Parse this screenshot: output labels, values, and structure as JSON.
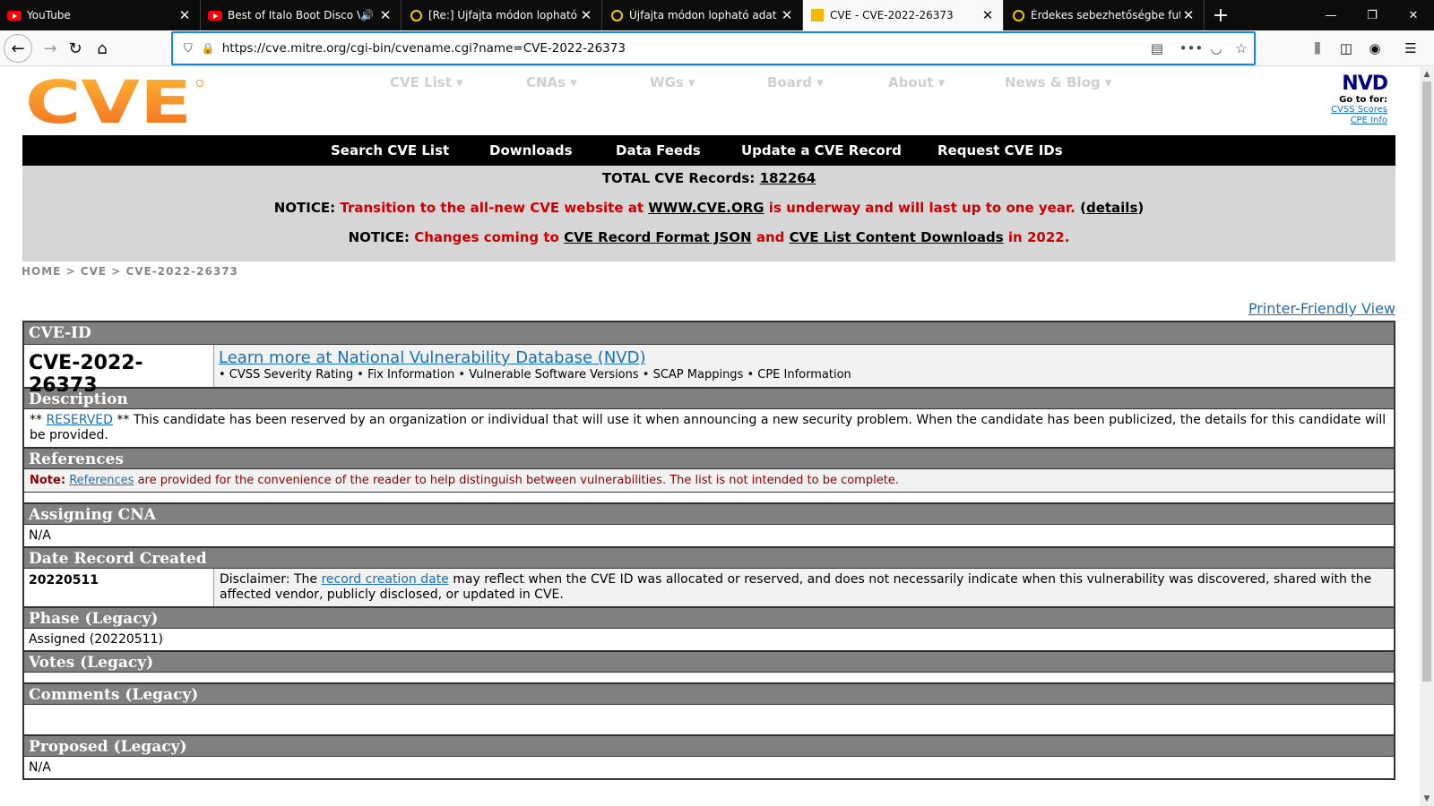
{
  "browser": {
    "tabs": [
      {
        "title": "YouTube",
        "favicon": "youtube-icon",
        "active": false
      },
      {
        "title": "Best of Italo Boot Disco Vol.",
        "favicon": "youtube-icon",
        "active": false,
        "audio": true
      },
      {
        "title": "[Re:] Újfajta módon lopható ad",
        "favicon": "ring-icon",
        "active": false
      },
      {
        "title": "Újfajta módon lopható adat az",
        "favicon": "ring-icon",
        "active": false
      },
      {
        "title": "CVE - CVE-2022-26373",
        "favicon": "square-icon",
        "active": true
      },
      {
        "title": "Érdekes sebezhetőségbe futott",
        "favicon": "ring-icon",
        "active": false
      }
    ],
    "url": "https://cve.mitre.org/cgi-bin/cvename.cgi?name=CVE-2022-26373"
  },
  "site": {
    "logo_text": "CVE",
    "top_nav": [
      "CVE List",
      "CNAs",
      "WGs",
      "Board",
      "About",
      "News & Blog"
    ],
    "nvd": {
      "mark": "NVD",
      "goto": "Go to for:",
      "links": [
        "CVSS Scores",
        "CPE Info"
      ]
    },
    "main_nav": [
      "Search CVE List",
      "Downloads",
      "Data Feeds",
      "Update a CVE Record",
      "Request CVE IDs"
    ],
    "total_label": "TOTAL CVE Records:",
    "total_value": "182264",
    "notice1": {
      "label": "NOTICE:",
      "text_a": "Transition to the all-new CVE website at",
      "link": "WWW.CVE.ORG",
      "text_b": "is underway and will last up to one year.",
      "details": "details"
    },
    "notice2": {
      "label": "NOTICE:",
      "text_a": "Changes coming to",
      "link1": "CVE Record Format JSON",
      "and": "and",
      "link2": "CVE List Content Downloads",
      "text_b": "in 2022."
    },
    "breadcrumb": "HOME > CVE > CVE-2022-26373",
    "printer_view": "Printer-Friendly View"
  },
  "record": {
    "h_id": "CVE-ID",
    "id": "CVE-2022-26373",
    "nvd_link": "Learn more at National Vulnerability Database (NVD)",
    "nvd_bullets": "• CVSS Severity Rating • Fix Information • Vulnerable Software Versions • SCAP Mappings • CPE Information",
    "h_description": "Description",
    "desc_prefix": "**",
    "desc_reserved": "RESERVED",
    "desc_text": "** This candidate has been reserved by an organization or individual that will use it when announcing a new security problem. When the candidate has been publicized, the details for this candidate will be provided.",
    "h_references": "References",
    "ref_note_label": "Note:",
    "ref_note_link": "References",
    "ref_note_text": "are provided for the convenience of the reader to help distinguish between vulnerabilities. The list is not intended to be complete.",
    "h_cna": "Assigning CNA",
    "cna": "N/A",
    "h_date": "Date Record Created",
    "date": "20220511",
    "disclaimer_a": "Disclaimer: The",
    "disclaimer_link": "record creation date",
    "disclaimer_b": "may reflect when the CVE ID was allocated or reserved, and does not necessarily indicate when this vulnerability was discovered, shared with the affected vendor, publicly disclosed, or updated in CVE.",
    "h_phase": "Phase (Legacy)",
    "phase": "Assigned (20220511)",
    "h_votes": "Votes (Legacy)",
    "h_comments": "Comments (Legacy)",
    "h_proposed": "Proposed (Legacy)",
    "proposed": "N/A"
  },
  "colors": {
    "logo_orange": "#f7941d",
    "nav_black": "#000000",
    "notice_red": "#cc0000",
    "header_grey": "#808080",
    "link_blue": "#1a6fb5"
  }
}
